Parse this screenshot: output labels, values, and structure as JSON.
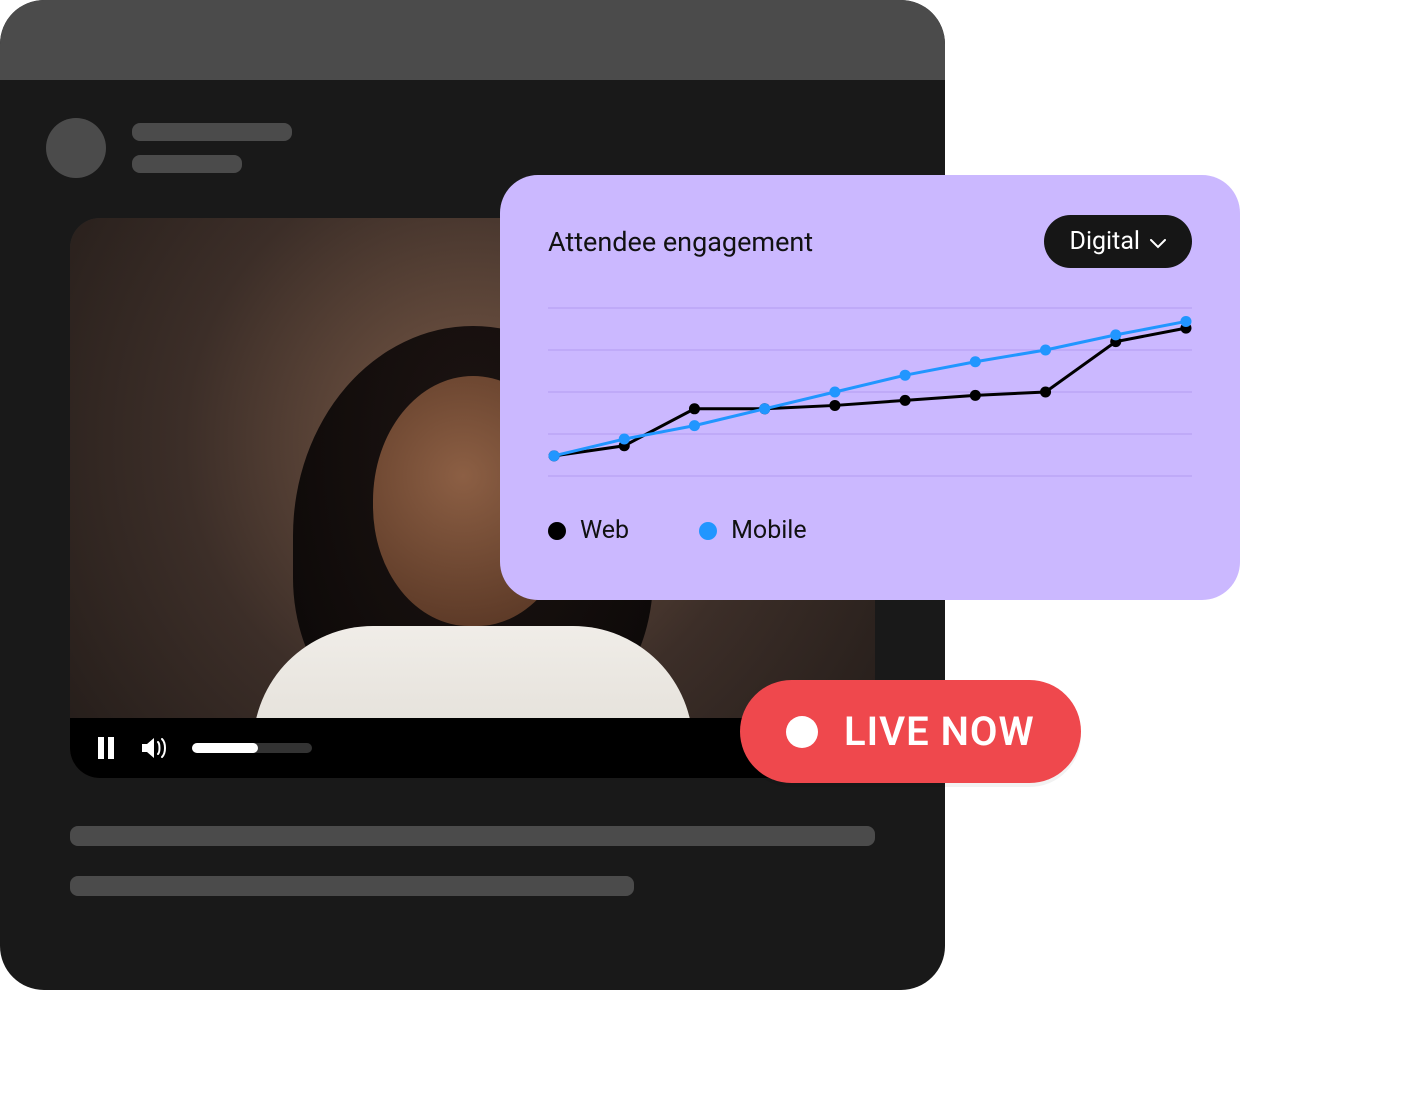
{
  "video_player": {
    "progress_pct": 55
  },
  "chart": {
    "title": "Attendee engagement",
    "filter_label": "Digital",
    "legend": {
      "web": "Web",
      "mobile": "Mobile"
    }
  },
  "chart_data": {
    "type": "line",
    "title": "Attendee engagement",
    "xlabel": "",
    "ylabel": "",
    "ylim": [
      0,
      100
    ],
    "x": [
      0,
      1,
      2,
      3,
      4,
      5,
      6,
      7,
      8,
      9
    ],
    "series": [
      {
        "name": "Web",
        "color": "#000000",
        "values": [
          12,
          18,
          40,
          40,
          42,
          45,
          48,
          50,
          80,
          88
        ]
      },
      {
        "name": "Mobile",
        "color": "#2196ff",
        "values": [
          12,
          22,
          30,
          40,
          50,
          60,
          68,
          75,
          84,
          92
        ]
      }
    ],
    "grid": true,
    "legend_position": "bottom"
  },
  "live": {
    "label": "LIVE NOW"
  }
}
